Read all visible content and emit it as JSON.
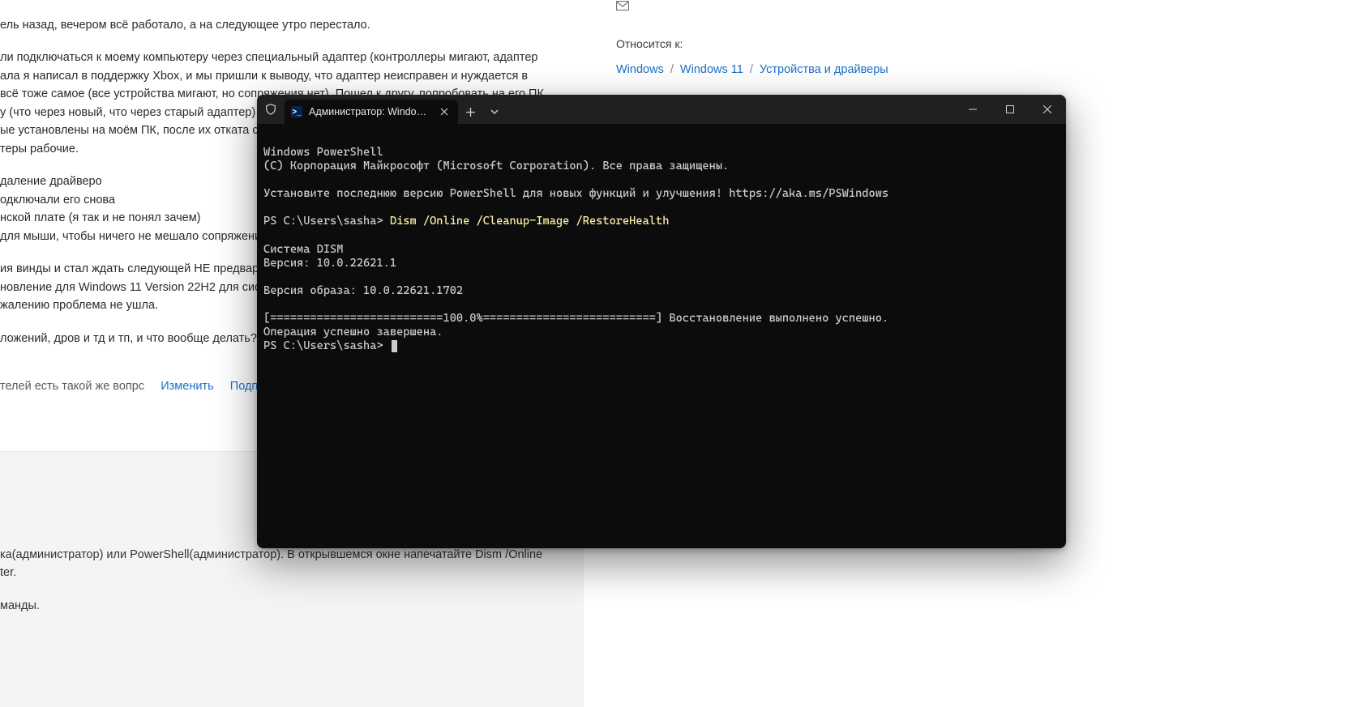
{
  "page": {
    "paragraphs": {
      "p1": "ель назад, вечером всё работало, а на следующее утро перестало.",
      "p2": "ли подключаться к моему компьютеру через специальный адаптер (контроллеры мигают, адаптер\nала я написал в поддержку Xbox, и мы пришли к выводу, что адаптер неисправен и нуждается в\n всё тоже самое (все устройства мигают, но сопряжения нет). Пошел к другу, попробовать на его ПК\nу (что через новый, что через старый адаптер) моментально, ...\nые установлены на моём ПК, после их отката ситуа...\nтеры рабочие.",
      "li1": "даление драйверо",
      "li2": "одключали его снова",
      "li3": "нской плате (я так и не понял зачем)",
      "li4": "для мыши, чтобы ничего не мешало сопряжению",
      "p3": "ия винды и стал ждать следующей НЕ предварител\nновление для Windows 11 Version 22H2 для систем н\nжалению проблема не ушла.",
      "p4": "ложений, дров и тд и тп, и что вообще делать???",
      "footer_text": "телей есть такой же вопрс",
      "link_edit": "Изменить",
      "link_subscribe": "Подписат",
      "lower1": "ка(администратор) или PowerShell(администратор). В открывшемся окне напечатайте Dism /Online\nter.",
      "lower2": "манды."
    }
  },
  "sidebar": {
    "applies_to": "Относится к:",
    "crumbs": [
      "Windows",
      "Windows 11",
      "Устройства и драйверы"
    ]
  },
  "terminal": {
    "tab_title": "Администратор: Windows Pc",
    "lines": [
      "Windows PowerShell",
      "(C) Корпорация Майкрософт (Microsoft Corporation). Все права защищены.",
      "",
      "Установите последнюю версию PowerShell для новых функций и улучшения! https://aka.ms/PSWindows",
      ""
    ],
    "prompt1_prefix": "PS C:\\Users\\sasha> ",
    "prompt1_cmd": "Dism /Online /Cleanup-Image /RestoreHealth",
    "after_cmd": [
      "",
      "Cистема DISM",
      "Версия: 10.0.22621.1",
      "",
      "Версия образа: 10.0.22621.1702",
      "",
      "[==========================100.0%==========================] Восстановление выполнено успешно.",
      "Операция успешно завершена.",
      "PS C:\\Users\\sasha> "
    ]
  }
}
